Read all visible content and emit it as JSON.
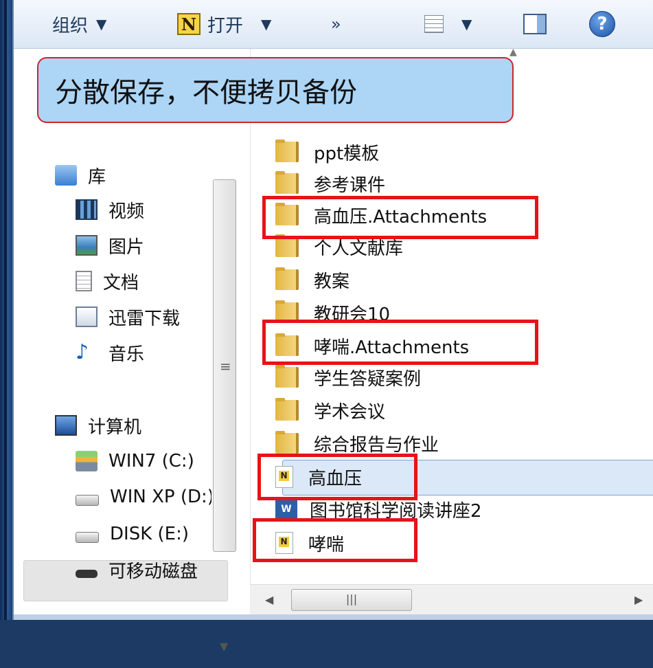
{
  "toolbar": {
    "organize": "组织",
    "open": "打开",
    "more": "»",
    "n_icon_letter": "N"
  },
  "callout": {
    "text": "分散保存，不便拷贝备份"
  },
  "nav": {
    "libraries": "库",
    "videos": "视频",
    "pictures": "图片",
    "documents": "文档",
    "xunlei": "迅雷下载",
    "music": "音乐",
    "computer": "计算机",
    "drive_c": "WIN7 (C:)",
    "drive_d": "WIN XP (D:)",
    "drive_e": "DISK (E:)",
    "removable": "可移动磁盘"
  },
  "files": [
    {
      "name": "ppt模板",
      "type": "folder"
    },
    {
      "name": "参考课件",
      "type": "folder"
    },
    {
      "name": "高血压.Attachments",
      "type": "folder"
    },
    {
      "name": "个人文献库",
      "type": "folder"
    },
    {
      "name": "教案",
      "type": "folder"
    },
    {
      "name": "教研会10",
      "type": "folder"
    },
    {
      "name": "哮喘.Attachments",
      "type": "folder"
    },
    {
      "name": "学生答疑案例",
      "type": "folder"
    },
    {
      "name": "学术会议",
      "type": "folder"
    },
    {
      "name": "综合报告与作业",
      "type": "folder"
    },
    {
      "name": "高血压",
      "type": "notefirst"
    },
    {
      "name": "图书馆科学阅读讲座2",
      "type": "word"
    },
    {
      "name": "哮喘",
      "type": "notefirst"
    }
  ],
  "colors": {
    "highlight": "#e8121a",
    "callout_bg": "#acd5f6",
    "selection": "#dbe8f8"
  }
}
